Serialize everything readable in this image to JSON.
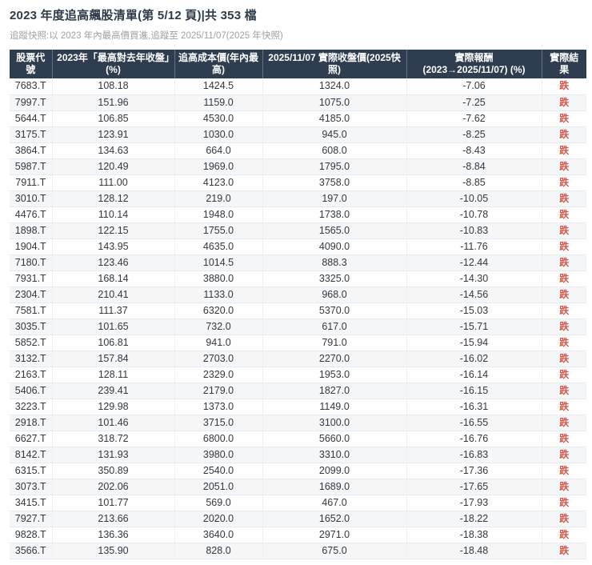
{
  "page": {
    "title": "2023 年度追高飆股清單(第 5/12 頁)|共 353 檔",
    "subtitle": "追蹤快照:以 2023 年內最高價買進,追蹤至 2025/11/07(2025 年快照)"
  },
  "colors": {
    "header_bg": "#2e3e50",
    "header_text": "#ffffff",
    "row_bg": "#ffffff",
    "row_alt_bg": "#f4f6f8",
    "body_text": "#32383e",
    "result_down": "#d9584e",
    "title_text": "#2e3b49",
    "subtitle_text": "#9da1a6",
    "grid_line": "#e7e9eb"
  },
  "table": {
    "columns": [
      {
        "key": "code",
        "label": "股票代號"
      },
      {
        "key": "surge_pct",
        "label": "2023年「最高對去年收盤」(%)"
      },
      {
        "key": "cost_price",
        "label": "追高成本價(年內最高)"
      },
      {
        "key": "close_price",
        "label": "2025/11/07 實際收盤價(2025快照)"
      },
      {
        "key": "actual_return",
        "label": "實際報酬\n(2023→2025/11/07) (%)"
      },
      {
        "key": "result",
        "label": "實際結果"
      }
    ],
    "rows": [
      [
        "7683.T",
        "108.18",
        "1424.5",
        "1324.0",
        "-7.06",
        "跌"
      ],
      [
        "7997.T",
        "151.96",
        "1159.0",
        "1075.0",
        "-7.25",
        "跌"
      ],
      [
        "5644.T",
        "106.85",
        "4530.0",
        "4185.0",
        "-7.62",
        "跌"
      ],
      [
        "3175.T",
        "123.91",
        "1030.0",
        "945.0",
        "-8.25",
        "跌"
      ],
      [
        "3864.T",
        "134.63",
        "664.0",
        "608.0",
        "-8.43",
        "跌"
      ],
      [
        "5987.T",
        "120.49",
        "1969.0",
        "1795.0",
        "-8.84",
        "跌"
      ],
      [
        "7911.T",
        "111.00",
        "4123.0",
        "3758.0",
        "-8.85",
        "跌"
      ],
      [
        "3010.T",
        "128.12",
        "219.0",
        "197.0",
        "-10.05",
        "跌"
      ],
      [
        "4476.T",
        "110.14",
        "1948.0",
        "1738.0",
        "-10.78",
        "跌"
      ],
      [
        "1898.T",
        "122.15",
        "1755.0",
        "1565.0",
        "-10.83",
        "跌"
      ],
      [
        "1904.T",
        "143.95",
        "4635.0",
        "4090.0",
        "-11.76",
        "跌"
      ],
      [
        "7180.T",
        "123.46",
        "1014.5",
        "888.3",
        "-12.44",
        "跌"
      ],
      [
        "7931.T",
        "168.14",
        "3880.0",
        "3325.0",
        "-14.30",
        "跌"
      ],
      [
        "2304.T",
        "210.41",
        "1133.0",
        "968.0",
        "-14.56",
        "跌"
      ],
      [
        "7581.T",
        "111.37",
        "6320.0",
        "5370.0",
        "-15.03",
        "跌"
      ],
      [
        "3035.T",
        "101.65",
        "732.0",
        "617.0",
        "-15.71",
        "跌"
      ],
      [
        "5852.T",
        "106.81",
        "941.0",
        "791.0",
        "-15.94",
        "跌"
      ],
      [
        "3132.T",
        "157.84",
        "2703.0",
        "2270.0",
        "-16.02",
        "跌"
      ],
      [
        "2163.T",
        "128.11",
        "2329.0",
        "1953.0",
        "-16.14",
        "跌"
      ],
      [
        "5406.T",
        "239.41",
        "2179.0",
        "1827.0",
        "-16.15",
        "跌"
      ],
      [
        "3223.T",
        "129.98",
        "1373.0",
        "1149.0",
        "-16.31",
        "跌"
      ],
      [
        "2918.T",
        "101.46",
        "3715.0",
        "3100.0",
        "-16.55",
        "跌"
      ],
      [
        "6627.T",
        "318.72",
        "6800.0",
        "5660.0",
        "-16.76",
        "跌"
      ],
      [
        "8142.T",
        "131.93",
        "3980.0",
        "3310.0",
        "-16.83",
        "跌"
      ],
      [
        "6315.T",
        "350.89",
        "2540.0",
        "2099.0",
        "-17.36",
        "跌"
      ],
      [
        "3073.T",
        "202.06",
        "2051.0",
        "1689.0",
        "-17.65",
        "跌"
      ],
      [
        "3415.T",
        "101.77",
        "569.0",
        "467.0",
        "-17.93",
        "跌"
      ],
      [
        "7927.T",
        "213.66",
        "2020.0",
        "1652.0",
        "-18.22",
        "跌"
      ],
      [
        "9828.T",
        "136.36",
        "3640.0",
        "2971.0",
        "-18.38",
        "跌"
      ],
      [
        "3566.T",
        "135.90",
        "828.0",
        "675.0",
        "-18.48",
        "跌"
      ]
    ],
    "result_down_value": "跌"
  }
}
